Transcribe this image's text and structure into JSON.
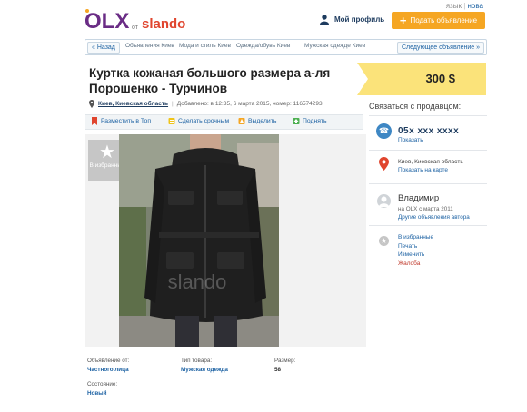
{
  "header": {
    "logo_olx": "OLX",
    "logo_from": "от",
    "logo_slando": "slando",
    "lang_label": "язык",
    "lang_value": "нова",
    "profile_label": "Мой профиль",
    "post_button": "Подать объявление"
  },
  "breadcrumb": {
    "back": "« Назад",
    "items": [
      "Объявления Киев",
      "Мода и стиль Киев",
      "Одежда/обувь Киев",
      "Мужская одежде Киев"
    ],
    "next": "Следующее объявление »"
  },
  "listing": {
    "title": "Куртка кожаная большого размера а-ля Порошенко - Турчинов",
    "price": "300 $",
    "location": "Киев, Киевская область",
    "added": "Добавлено: в 12:35, 6 марта 2015, номер: 116574293"
  },
  "actions": [
    "Разместить в Топ",
    "Сделать срочным",
    "Выделить",
    "Поднять"
  ],
  "gallery": {
    "favorite_label": "В избранные",
    "watermark": "slando"
  },
  "contact": {
    "header": "Связаться с продавцом:",
    "phone": "05х ххх хххх",
    "phone_show": "Показать",
    "location": "Киев, Киевская область",
    "show_map": "Показать на карте",
    "user_name": "Владимир",
    "user_since": "на OLX с марта 2011",
    "user_other": "Другие объявления автора",
    "links": [
      "В избранные",
      "Печать",
      "Изменить",
      "Жалоба"
    ]
  },
  "details": [
    {
      "label": "Объявление от:",
      "value": "Частного лица"
    },
    {
      "label": "Тип товара:",
      "value": "Мужская одежда"
    },
    {
      "label": "Размер:",
      "value": "58"
    },
    {
      "label": "Состояние:",
      "value": "Новый"
    }
  ],
  "colors": {
    "accent": "#f5a623",
    "price_bg": "#fbe37a",
    "link": "#1d62a3",
    "olx_purple": "#8a2b82"
  }
}
